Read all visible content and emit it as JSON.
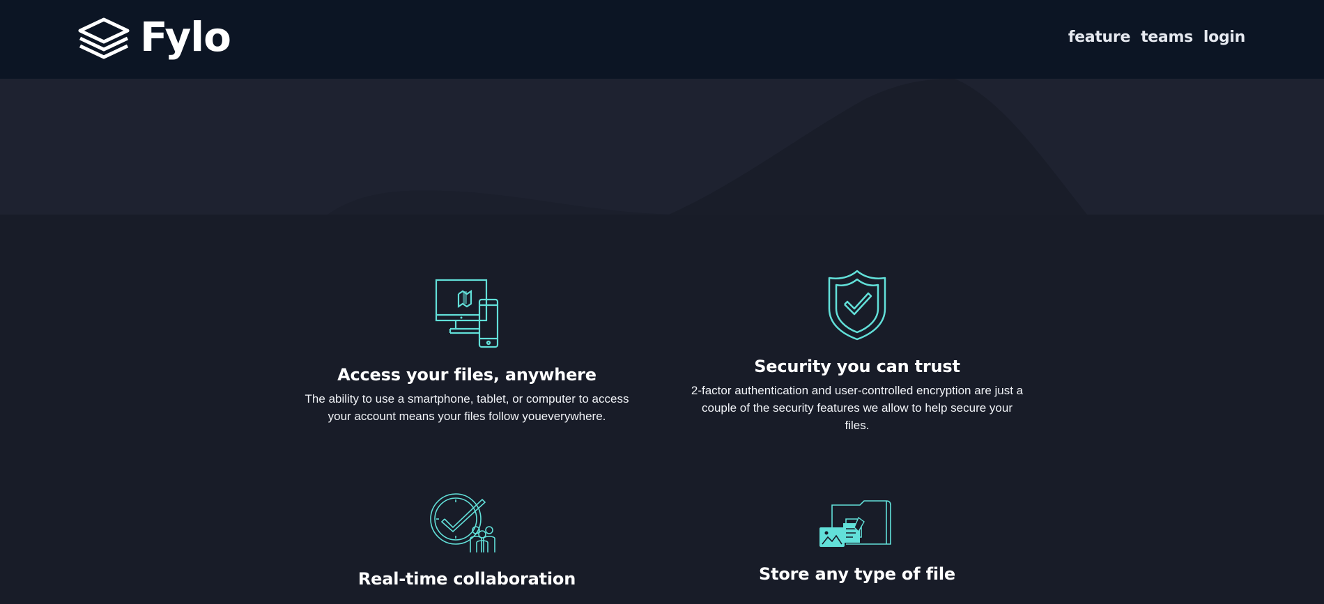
{
  "header": {
    "brand": "Fylo",
    "nav": [
      "feature",
      "teams",
      "login"
    ]
  },
  "features": [
    {
      "title": "Access your files, anywhere",
      "description": "The ability to use a smartphone, tablet, or computer to access your account means your files follow youeverywhere.",
      "icon": "devices-icon"
    },
    {
      "title": "Security you can trust",
      "description": "2-factor authentication and user-controlled encryption are just a couple of the security features we allow to help secure your files.",
      "icon": "shield-check-icon"
    },
    {
      "title": "Real-time collaboration",
      "description": "",
      "icon": "collaboration-icon"
    },
    {
      "title": "Store any type of file",
      "description": "",
      "icon": "folder-files-icon"
    }
  ],
  "colors": {
    "header_bg": "#0c1524",
    "page_bg": "#181c28",
    "hero_bg": "#1d2231",
    "accent": "#62e0d9",
    "text": "#ffffff"
  }
}
